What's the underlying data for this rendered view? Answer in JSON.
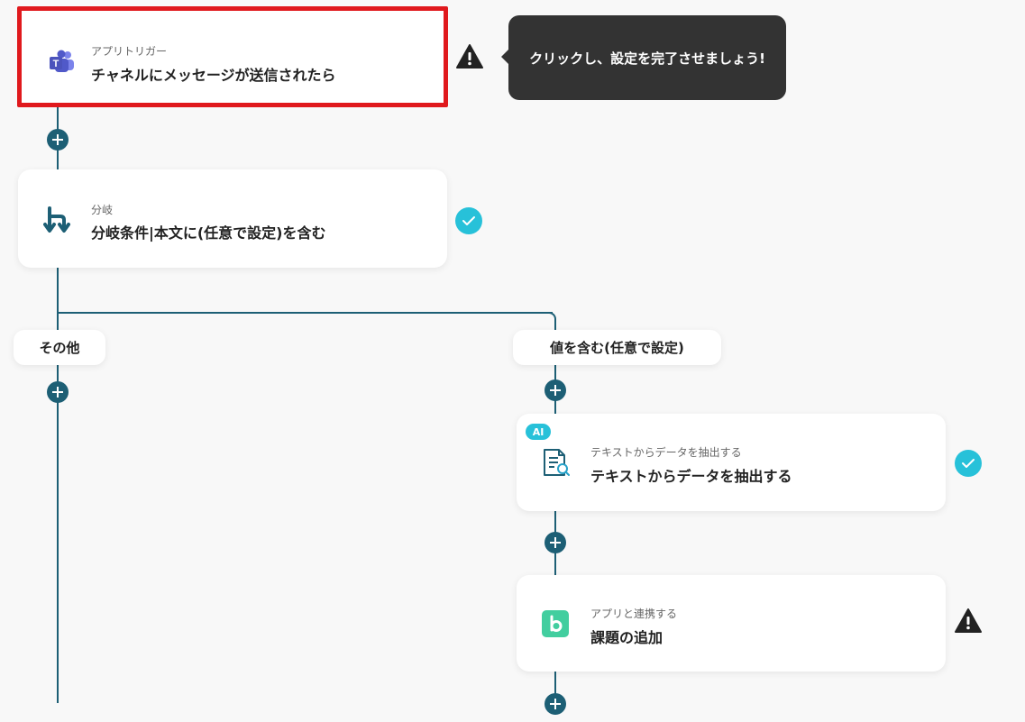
{
  "trigger_card": {
    "sub": "アプリトリガー",
    "title": "チャネルにメッセージが送信されたら",
    "icon": "teams-icon",
    "highlight_color": "#e0191d"
  },
  "tooltip": {
    "text": "クリックし、設定を完了させましょう!"
  },
  "branch_card": {
    "sub": "分岐",
    "title": "分岐条件|本文に(任意で設定)を含む",
    "icon": "branch-icon"
  },
  "branches": {
    "left_label": "その他",
    "right_label": "値を含む(任意で設定)"
  },
  "extract_card": {
    "badge": "AI",
    "sub": "テキストからデータを抽出する",
    "title": "テキストからデータを抽出する",
    "icon": "document-search-icon"
  },
  "app_card": {
    "sub": "アプリと連携する",
    "title": "課題の追加",
    "icon": "backlog-icon"
  },
  "colors": {
    "line": "#1d5f75",
    "check": "#27c1d9",
    "tooltip_bg": "#333333",
    "backlog": "#42ce9f",
    "teams": "#5059c9"
  }
}
